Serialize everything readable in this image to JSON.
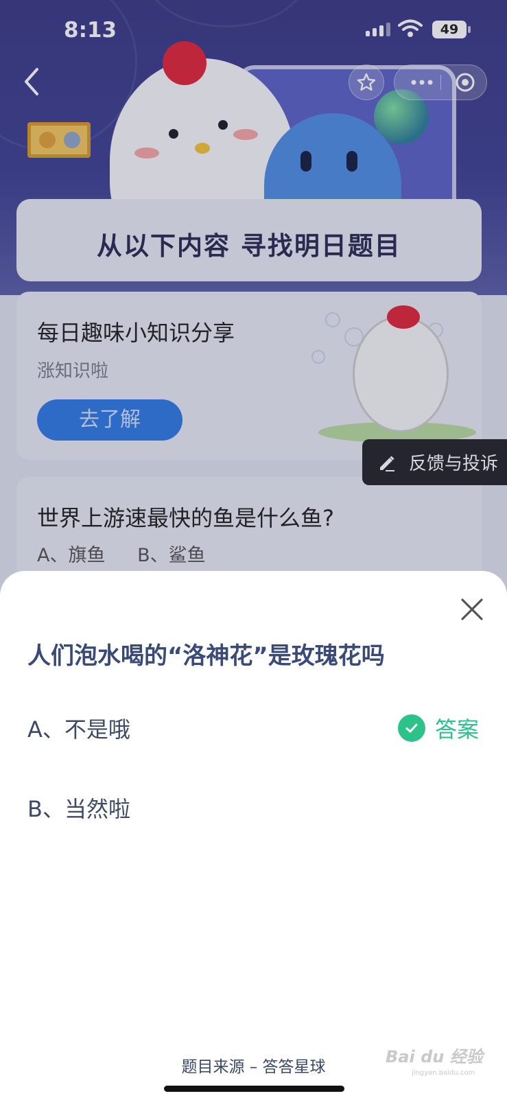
{
  "status_bar": {
    "time": "8:13",
    "battery": "49"
  },
  "page": {
    "section_title": "从以下内容  寻找明日题目",
    "card1": {
      "title": "每日趣味小知识分享",
      "subtitle": "涨知识啦",
      "button": "去了解"
    },
    "card2": {
      "question": "世界上游速最快的鱼是什么鱼?",
      "option_a": "A、旗鱼",
      "option_b": "B、鲨鱼"
    },
    "feedback_label": "反馈与投诉"
  },
  "sheet": {
    "question": "人们泡水喝的“洛神花”是玫瑰花吗",
    "options": [
      {
        "label": "A、不是哦",
        "is_answer": true
      },
      {
        "label": "B、当然啦",
        "is_answer": false
      }
    ],
    "answer_label": "答案",
    "source": "题目来源 – 答答星球"
  },
  "watermark": {
    "text": "Bai du 经验",
    "sub": "jingyan.baidu.com"
  },
  "colors": {
    "accent_green": "#2cc28a",
    "question_color": "#3a4a78",
    "primary_blue": "#2f7be6"
  }
}
